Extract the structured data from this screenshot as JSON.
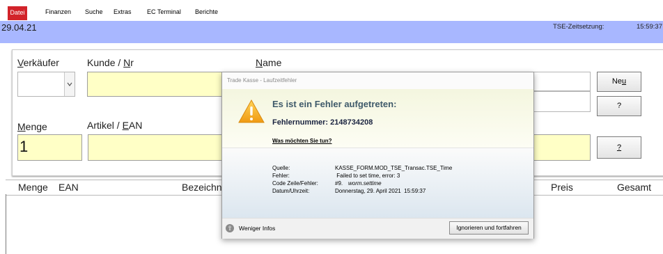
{
  "menu": {
    "items": [
      "Datei",
      "Finanzen",
      "Suche",
      "Extras",
      "EC Terminal",
      "Berichte"
    ],
    "active": "Datei"
  },
  "header": {
    "date": "29.04.21",
    "tse_label": "TSE-Zeitsetzung:",
    "tse_time": "15:59:37"
  },
  "form": {
    "verkaeufer_pre": "",
    "verkaeufer_key": "V",
    "verkaeufer_post": "erkäufer",
    "kunde_pre": "Kunde / ",
    "kunde_key": "N",
    "kunde_post": "r",
    "name_pre": "",
    "name_key": "N",
    "name_post": "ame",
    "menge_pre": "",
    "menge_key": "M",
    "menge_post": "enge",
    "artikel_pre": "Artikel / ",
    "artikel_key": "E",
    "artikel_post": "AN",
    "menge_value": "1",
    "neu_pre": "Ne",
    "neu_key": "u",
    "btn_q1": "?",
    "btn_q2": "?"
  },
  "grid": {
    "columns": [
      "Menge",
      "EAN",
      "Bezeichnung",
      "Preis",
      "Gesamt"
    ]
  },
  "dialog": {
    "title": "Trade Kasse - Laufzeitfehler",
    "heading": "Es ist ein Fehler aufgetreten:",
    "error_number": "Fehlernummer: 2148734208",
    "question": "Was möchten Sie tun?",
    "details": [
      {
        "key": "Quelle:",
        "value": "KASSE_FORM.MOD_TSE_Transac.TSE_Time"
      },
      {
        "key": "Fehler:",
        "value": " Failed to set time, error: 3"
      },
      {
        "key": "Code Zeile/Fehler:",
        "value": "#9.",
        "extra": "worm.settime"
      },
      {
        "key": "Datum/Uhrzeit:",
        "value": "Donnerstag, 29. April 2021  15:59:37"
      }
    ],
    "less_info": "Weniger Infos",
    "ignore_button": "Ignorieren und fortfahren",
    "colors": {
      "warning": "#f5a623",
      "heading": "#3f5a6a"
    }
  }
}
